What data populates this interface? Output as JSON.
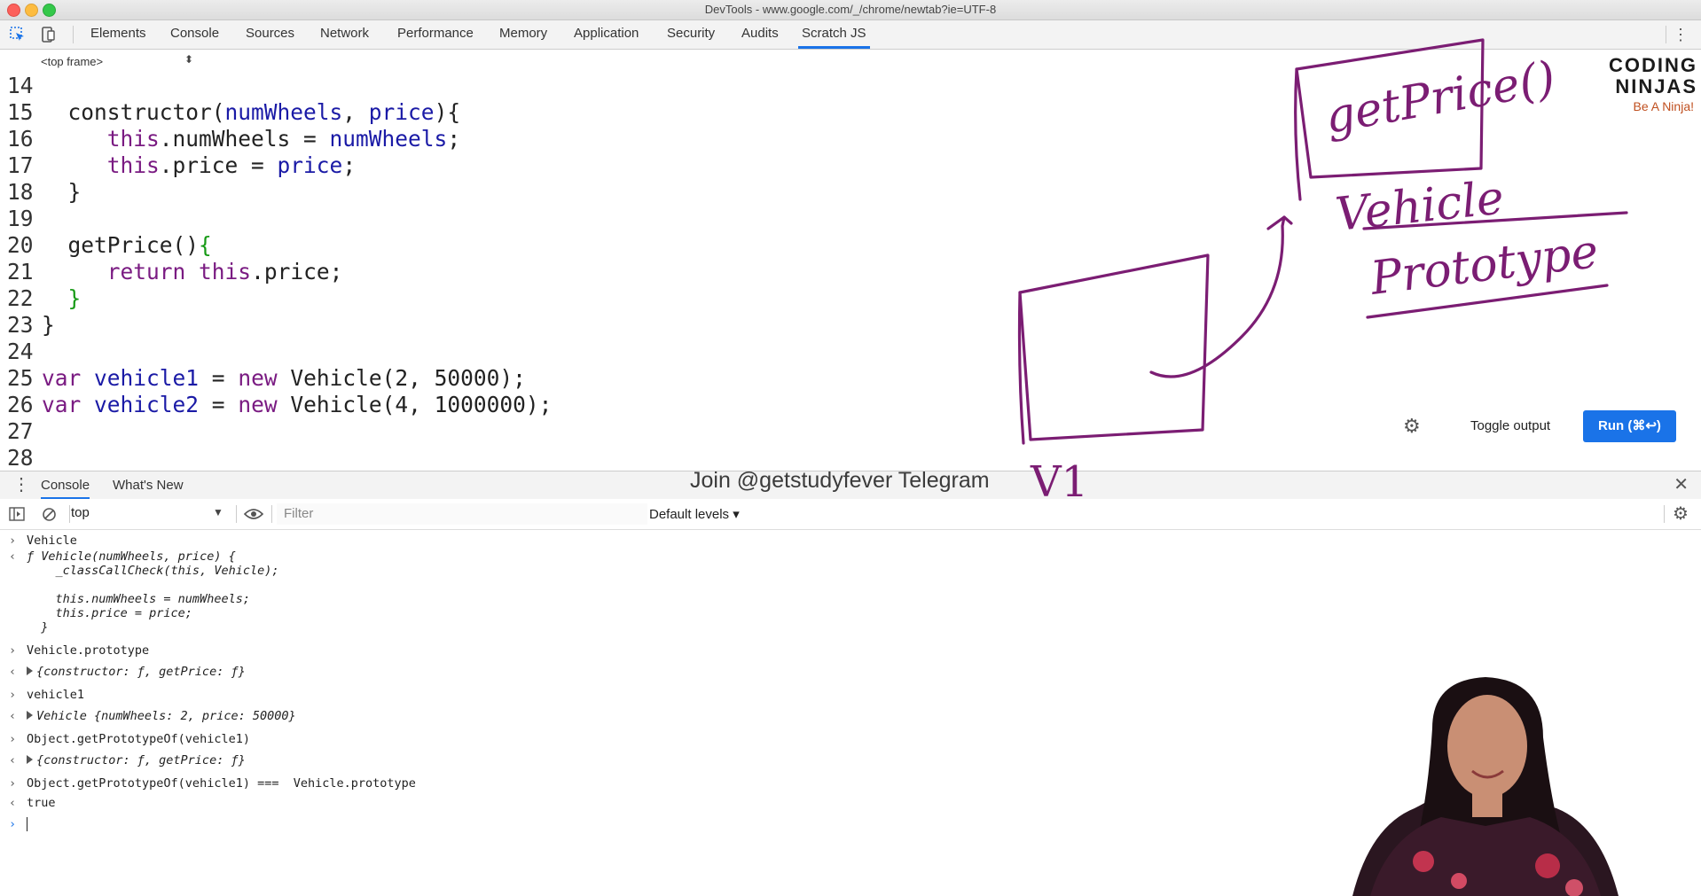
{
  "window": {
    "title": "DevTools - www.google.com/_/chrome/newtab?ie=UTF-8"
  },
  "tabs": [
    "Elements",
    "Console",
    "Sources",
    "Network",
    "Performance",
    "Memory",
    "Application",
    "Security",
    "Audits",
    "Scratch JS"
  ],
  "active_tab": "Scratch JS",
  "frame_selector": {
    "value": "<top frame>"
  },
  "editor": {
    "lines": [
      {
        "n": "14",
        "t": ""
      },
      {
        "n": "15",
        "t": "  constructor(numWheels, price){"
      },
      {
        "n": "16",
        "t": "     this.numWheels = numWheels;"
      },
      {
        "n": "17",
        "t": "     this.price = price;"
      },
      {
        "n": "18",
        "t": "  }"
      },
      {
        "n": "19",
        "t": ""
      },
      {
        "n": "20",
        "t": "  getPrice(){"
      },
      {
        "n": "21",
        "t": "     return this.price;"
      },
      {
        "n": "22",
        "t": "  }"
      },
      {
        "n": "23",
        "t": "}"
      },
      {
        "n": "24",
        "t": ""
      },
      {
        "n": "25",
        "t": "var vehicle1 = new Vehicle(2, 50000);"
      },
      {
        "n": "26",
        "t": "var vehicle2 = new Vehicle(4, 1000000);"
      },
      {
        "n": "27",
        "t": ""
      },
      {
        "n": "28",
        "t": ""
      }
    ]
  },
  "scratch_controls": {
    "toggle_label": "Toggle output",
    "run_label": "Run (⌘↩)"
  },
  "drawer": {
    "tabs": [
      "Console",
      "What's New"
    ],
    "active": "Console"
  },
  "watermark": "Join @getstudyfever Telegram",
  "console_toolbar": {
    "context": "top",
    "filter_placeholder": "Filter",
    "levels_label": "Default levels ▾"
  },
  "console": {
    "entries": [
      {
        "type": "in",
        "text": "Vehicle"
      },
      {
        "type": "out-fn",
        "lines": [
          "ƒ Vehicle(numWheels, price) {",
          "    _classCallCheck(this, Vehicle);",
          "",
          "    this.numWheels = numWheels;",
          "    this.price = price;",
          "  }"
        ]
      },
      {
        "type": "in",
        "text": "Vehicle.prototype"
      },
      {
        "type": "out-obj",
        "text": "{constructor: ƒ, getPrice: ƒ}"
      },
      {
        "type": "in",
        "text": "vehicle1"
      },
      {
        "type": "out-obj",
        "text": "Vehicle {numWheels: 2, price: 50000}"
      },
      {
        "type": "in",
        "text": "Object.getPrototypeOf(vehicle1)"
      },
      {
        "type": "out-obj",
        "text": "{constructor: ƒ, getPrice: ƒ}"
      },
      {
        "type": "in",
        "text": "Object.getPrototypeOf(vehicle1) ===  Vehicle.prototype"
      },
      {
        "type": "out",
        "text": "true"
      }
    ]
  },
  "annotations": {
    "box_label": "getPrice()",
    "vehicle_label": "Vehicle",
    "prototype_label": "Prototype",
    "v1_label": "V1"
  },
  "logo": {
    "name": "CODING NINJAS",
    "tagline": "Be A Ninja!"
  },
  "colors": {
    "accent": "#1a73e8",
    "ink": "#7b1d73"
  }
}
